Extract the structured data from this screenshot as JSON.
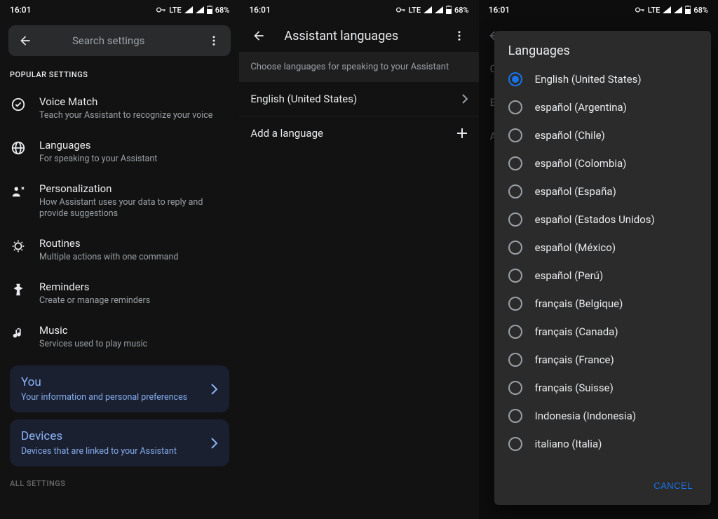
{
  "status": {
    "time": "16:01",
    "net": "LTE",
    "battery": "68%"
  },
  "panel1": {
    "search_placeholder": "Search settings",
    "section_label": "POPULAR SETTINGS",
    "items": [
      {
        "title": "Voice Match",
        "sub": "Teach your Assistant to recognize your voice"
      },
      {
        "title": "Languages",
        "sub": "For speaking to your Assistant"
      },
      {
        "title": "Personalization",
        "sub": "How Assistant uses your data to reply and provide suggestions"
      },
      {
        "title": "Routines",
        "sub": "Multiple actions with one command"
      },
      {
        "title": "Reminders",
        "sub": "Create or manage reminders"
      },
      {
        "title": "Music",
        "sub": "Services used to play music"
      }
    ],
    "card_you": {
      "title": "You",
      "sub": "Your information and personal preferences"
    },
    "card_devices": {
      "title": "Devices",
      "sub": "Devices that are linked to your Assistant"
    },
    "all_settings_label": "ALL SETTINGS"
  },
  "panel2": {
    "title": "Assistant languages",
    "info": "Choose languages for speaking to your Assistant",
    "primary_language": "English (United States)",
    "add_label": "Add a language"
  },
  "panel3": {
    "ghost_rows": [
      "C",
      "E",
      "A"
    ],
    "dialog_title": "Languages",
    "languages": [
      {
        "label": "English (United States)",
        "selected": true
      },
      {
        "label": "español (Argentina)",
        "selected": false
      },
      {
        "label": "español (Chile)",
        "selected": false
      },
      {
        "label": "español (Colombia)",
        "selected": false
      },
      {
        "label": "español (España)",
        "selected": false
      },
      {
        "label": "español (Estados Unidos)",
        "selected": false
      },
      {
        "label": "español (México)",
        "selected": false
      },
      {
        "label": "español (Perú)",
        "selected": false
      },
      {
        "label": "français (Belgique)",
        "selected": false
      },
      {
        "label": "français (Canada)",
        "selected": false
      },
      {
        "label": "français (France)",
        "selected": false
      },
      {
        "label": "français (Suisse)",
        "selected": false
      },
      {
        "label": "Indonesia (Indonesia)",
        "selected": false
      },
      {
        "label": "italiano (Italia)",
        "selected": false
      }
    ],
    "cancel": "CANCEL"
  }
}
